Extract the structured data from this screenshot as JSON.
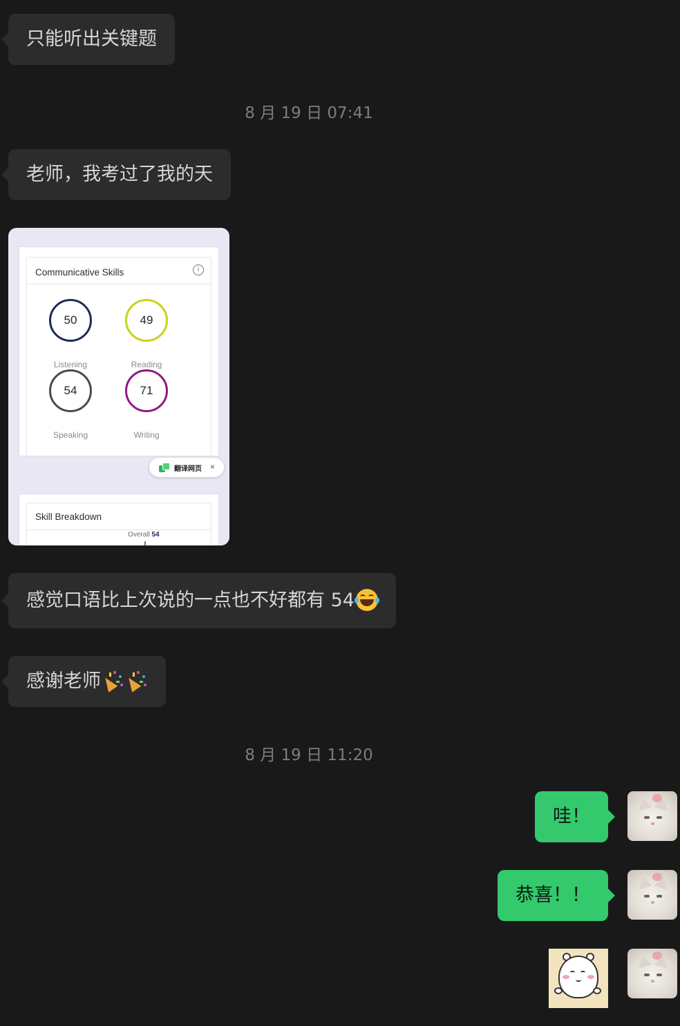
{
  "messages": {
    "m1": "只能听出关键题",
    "ts1": "8 月 19 日 07:41",
    "m2": "老师，我考过了我的天",
    "m3": "感觉口语比上次说的一点也不好都有 54",
    "m4": "感谢老师",
    "ts2": "8 月 19 日 11:20",
    "out1": "哇！",
    "out2": "恭喜！！"
  },
  "screenshot": {
    "title": "Communicative Skills",
    "info": "i",
    "scores": [
      {
        "value": "50",
        "label": "Listening",
        "color": "#1b2b52"
      },
      {
        "value": "49",
        "label": "Reading",
        "color": "#c9d21a"
      },
      {
        "value": "54",
        "label": "Speaking",
        "color": "#4a4a4a"
      },
      {
        "value": "71",
        "label": "Writing",
        "color": "#8e1883"
      }
    ],
    "translate_label": "翻译网页",
    "translate_close": "×",
    "breakdown_title": "Skill Breakdown",
    "overall_label": "Overall",
    "overall_value": "54"
  },
  "icons": {
    "laugh": "face-with-tears-of-joy-icon",
    "popper": "party-popper-icon",
    "translate": "translate-icon",
    "info": "info-icon"
  },
  "colors": {
    "background": "#191919",
    "incoming_bubble": "#2c2c2c",
    "outgoing_bubble": "#33c96c"
  }
}
